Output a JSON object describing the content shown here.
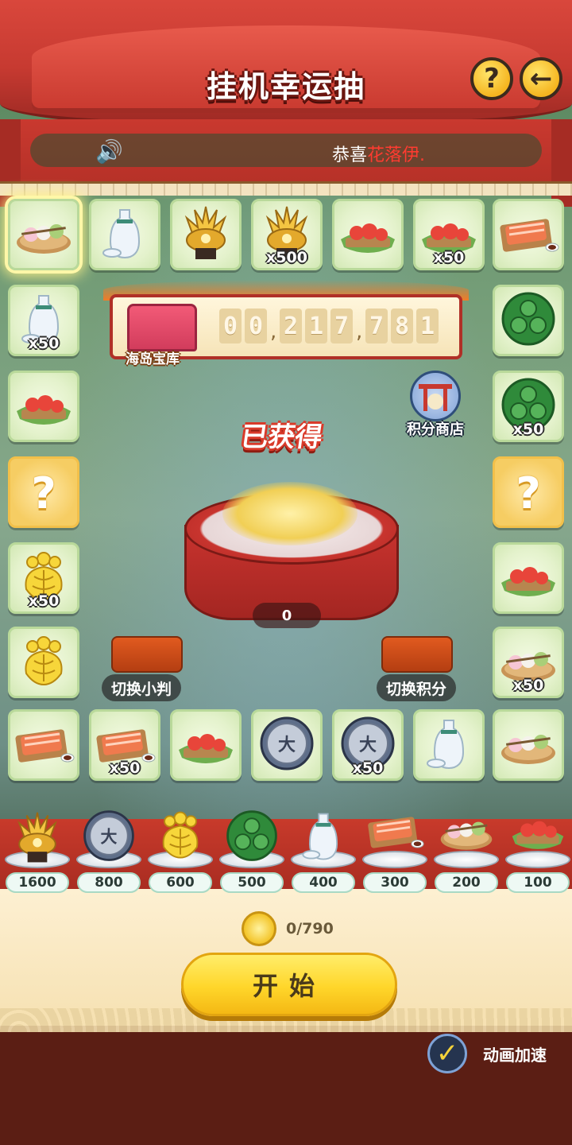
{
  "header": {
    "title": "挂机幸运抽",
    "help_symbol": "?",
    "back_symbol": "←"
  },
  "marquee": {
    "prefix": "恭喜",
    "name": "花落伊",
    "suffix": "."
  },
  "counter": {
    "label": "海岛宝库",
    "digits": [
      "0",
      "0",
      ",",
      "2",
      "1",
      "7",
      ",",
      "7",
      "8",
      "1"
    ]
  },
  "shop": {
    "label": "积分商店"
  },
  "obtained_label": "已获得",
  "drum": {
    "count": "0"
  },
  "switches": {
    "left": "切换小判",
    "right": "切换积分"
  },
  "board": {
    "top_row": [
      {
        "item": "dango",
        "qty": ""
      },
      {
        "item": "sake",
        "qty": ""
      },
      {
        "item": "kabuto",
        "qty": ""
      },
      {
        "item": "kabuto",
        "qty": "x500"
      },
      {
        "item": "tomato",
        "qty": ""
      },
      {
        "item": "tomato",
        "qty": "x50"
      },
      {
        "item": "salmon",
        "qty": ""
      }
    ],
    "left_col": [
      {
        "item": "sake",
        "qty": "x50"
      },
      {
        "item": "tomato",
        "qty": ""
      },
      {
        "item": "mystery",
        "qty": "",
        "symbol": "?"
      },
      {
        "item": "gold-crest",
        "qty": "x50"
      },
      {
        "item": "gold-crest",
        "qty": ""
      }
    ],
    "right_col": [
      {
        "item": "green-crest",
        "qty": ""
      },
      {
        "item": "green-crest",
        "qty": "x50"
      },
      {
        "item": "mystery",
        "qty": "",
        "symbol": "?"
      },
      {
        "item": "tomato",
        "qty": ""
      },
      {
        "item": "dango",
        "qty": "x50"
      }
    ],
    "bottom_row": [
      {
        "item": "salmon",
        "qty": ""
      },
      {
        "item": "salmon",
        "qty": "x50"
      },
      {
        "item": "tomato",
        "qty": ""
      },
      {
        "item": "silver-coin",
        "qty": ""
      },
      {
        "item": "silver-coin",
        "qty": "x50"
      },
      {
        "item": "sake",
        "qty": ""
      },
      {
        "item": "dango",
        "qty": ""
      }
    ]
  },
  "prizes": [
    {
      "item": "kabuto",
      "price": "1600"
    },
    {
      "item": "silver-coin",
      "price": "800"
    },
    {
      "item": "gold-crest",
      "price": "600"
    },
    {
      "item": "green-crest",
      "price": "500"
    },
    {
      "item": "sake",
      "price": "400"
    },
    {
      "item": "salmon",
      "price": "300"
    },
    {
      "item": "dango",
      "price": "200"
    },
    {
      "item": "tomato",
      "price": "100"
    }
  ],
  "cost": {
    "text": "0/790"
  },
  "start_label": "开始",
  "speed_toggle": {
    "label": "动画加速",
    "checked": true
  },
  "colors": {
    "accent_red": "#c8392f",
    "button_yellow": "#ffd62a",
    "tile_green": "#e4f2cc"
  }
}
